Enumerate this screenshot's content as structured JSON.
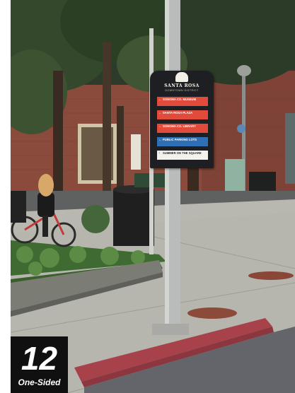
{
  "sign": {
    "title": "SANTA ROSA",
    "subtitle": "DOWNTOWN DISTRICT",
    "destinations": [
      {
        "label": "SONOMA CO. MUSEUM",
        "sub": "",
        "color": "#e14b3b",
        "arrow": "←"
      },
      {
        "label": "SANTA ROSA PLAZA",
        "sub": "",
        "color": "#e14b3b",
        "arrow": "←"
      },
      {
        "label": "SONOMA CO. LIBRARY",
        "sub": "",
        "color": "#e14b3b",
        "arrow": "←"
      },
      {
        "label": "PUBLIC PARKING LOTS",
        "sub": "",
        "color": "#2e6fb6",
        "arrow": "←"
      },
      {
        "label": "SUMMER ON THE SQUARE",
        "sub": "",
        "color": "#f4f2ec",
        "arrow": "↑"
      }
    ]
  },
  "badge": {
    "number": "12",
    "label": "One-Sided"
  },
  "colors": {
    "sign_panel": "#1d1f22",
    "badge_bg": "#101010",
    "curb_red": "#a8424a"
  }
}
